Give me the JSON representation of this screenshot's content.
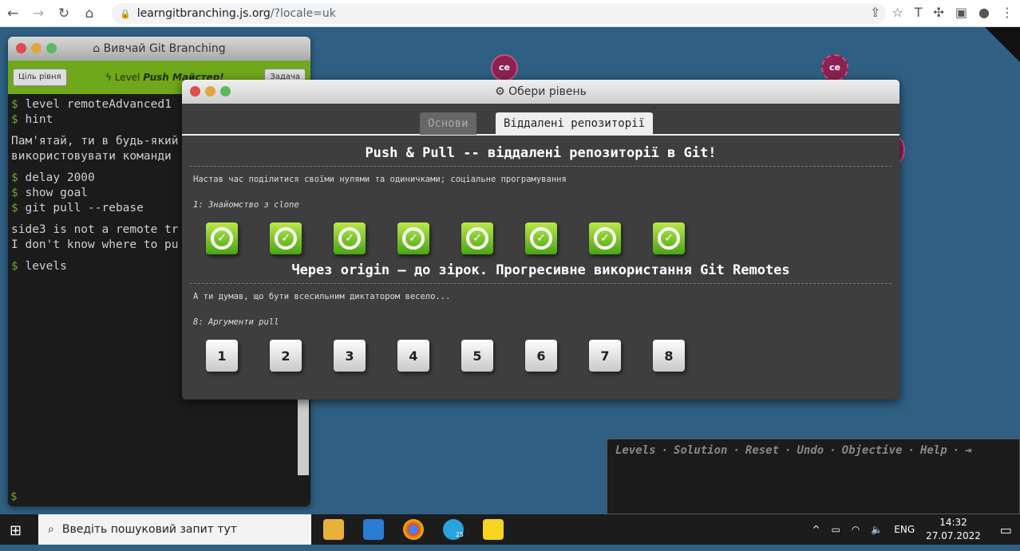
{
  "browser": {
    "url_host": "learngitbranching.js.org",
    "url_path": "/?locale=uk"
  },
  "graph": {
    "commit_label": "ce"
  },
  "terminal": {
    "title": "Вивчай Git Branching",
    "goal_button": "Ціль рівня",
    "level_prefix": "Level",
    "level_name": "Push Майстер!",
    "task_button": "Задача",
    "lines": [
      {
        "prompt": "$",
        "text": "level remoteAdvanced1"
      },
      {
        "prompt": "$",
        "text": "hint"
      },
      {
        "gap": true
      },
      {
        "prompt": "",
        "text": "Пам'ятай, ти в будь-який"
      },
      {
        "prompt": "",
        "text": "використовувати команди"
      },
      {
        "gap": true
      },
      {
        "prompt": "$",
        "text": "delay 2000"
      },
      {
        "prompt": "$",
        "text": "show goal"
      },
      {
        "prompt": "$",
        "text": "git pull --rebase"
      },
      {
        "gap": true
      },
      {
        "prompt": "",
        "text": "side3 is not a remote tr"
      },
      {
        "prompt": "",
        "text": "I don't know where to pu"
      },
      {
        "gap": true
      },
      {
        "prompt": "$",
        "text": "levels"
      }
    ],
    "input_prompt": "$"
  },
  "modal": {
    "title": "Обери рівень",
    "tabs": [
      {
        "label": "Основи",
        "active": false
      },
      {
        "label": "Віддалені репозиторії",
        "active": true
      }
    ],
    "sections": [
      {
        "heading": "Push & Pull -- віддалені репозиторії в Git!",
        "description": "Настав час поділитися своїми нулями та одиничками; соціальне програмування",
        "selected": "1: Знайомство з clone",
        "levels": [
          {
            "label": "1",
            "done": true
          },
          {
            "label": "2",
            "done": true
          },
          {
            "label": "3",
            "done": true
          },
          {
            "label": "4",
            "done": true
          },
          {
            "label": "5",
            "done": true
          },
          {
            "label": "6",
            "done": true
          },
          {
            "label": "7",
            "done": true
          },
          {
            "label": "8",
            "done": true
          }
        ]
      },
      {
        "heading": "Через origin – до зірок. Прогресивне використання Git Remotes",
        "description": "А ти думав, що бути всесильним диктатором весело...",
        "selected": "8: Аргументи pull",
        "levels": [
          {
            "label": "1",
            "done": false
          },
          {
            "label": "2",
            "done": false
          },
          {
            "label": "3",
            "done": false
          },
          {
            "label": "4",
            "done": false
          },
          {
            "label": "5",
            "done": false
          },
          {
            "label": "6",
            "done": false
          },
          {
            "label": "7",
            "done": false
          },
          {
            "label": "8",
            "done": false
          }
        ]
      }
    ]
  },
  "command_bar": {
    "items": [
      "Levels",
      "Solution",
      "Reset",
      "Undo",
      "Objective",
      "Help"
    ],
    "separator": "·"
  },
  "taskbar": {
    "search_placeholder": "Введіть пошуковий запит тут",
    "language": "ENG",
    "time": "14:32",
    "date": "27.07.2022",
    "telegram_badge": "25"
  },
  "colors": {
    "background": "#2f5f82",
    "terminal_green": "#6fa81b",
    "commit": "#8b2252"
  }
}
